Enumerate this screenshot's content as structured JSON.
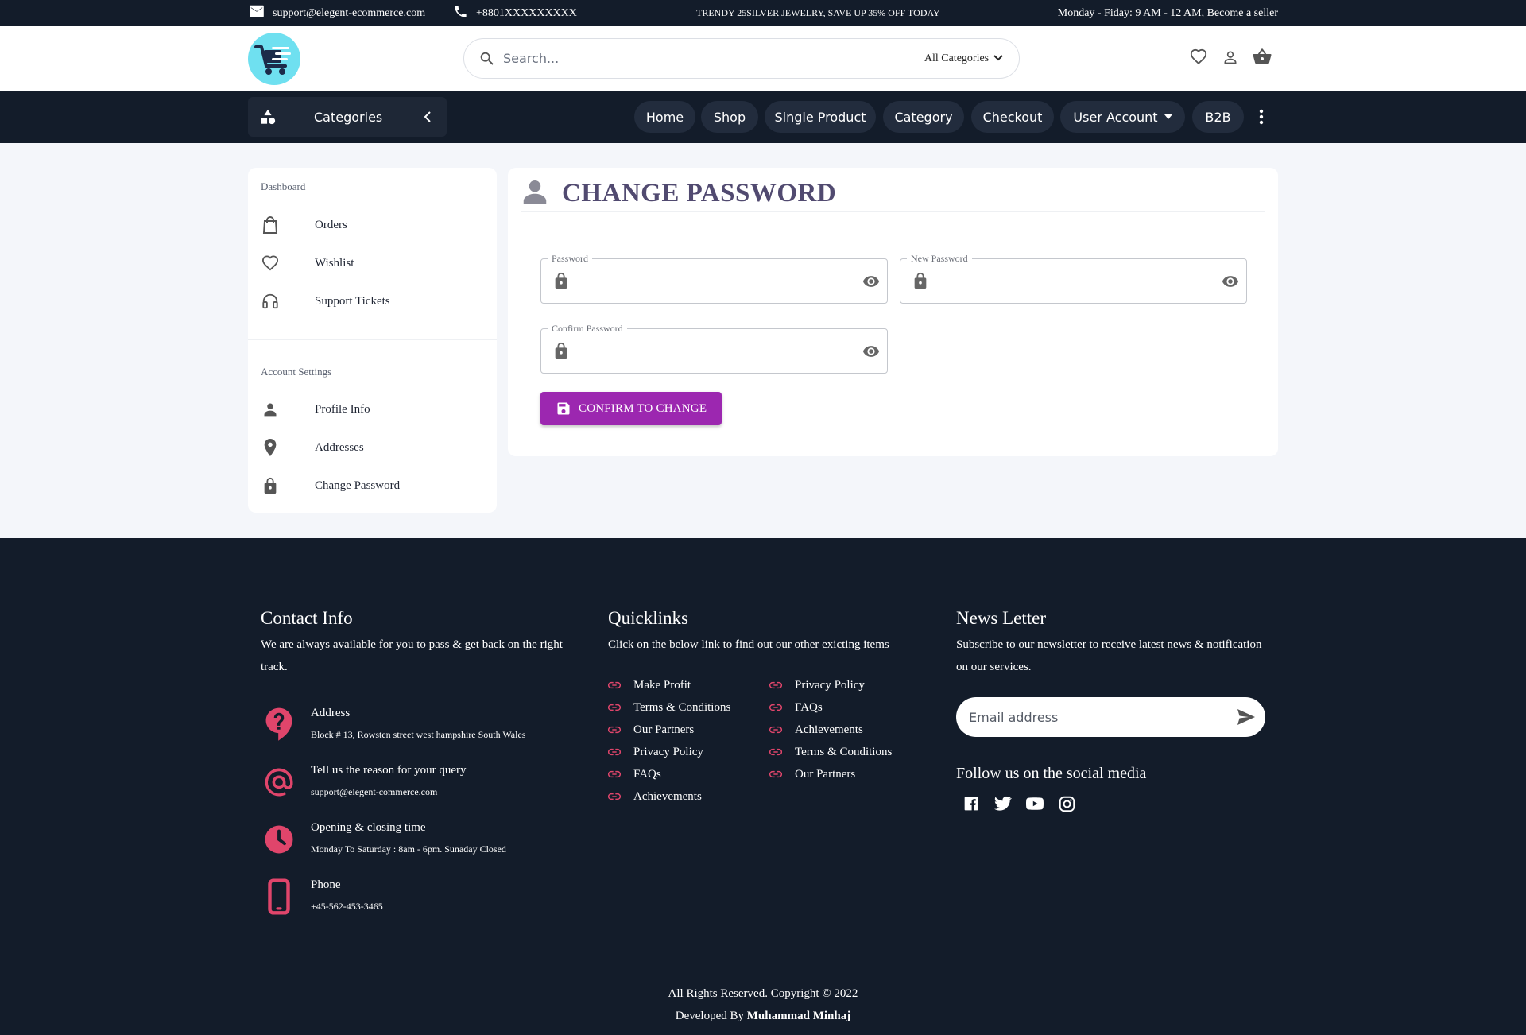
{
  "topbar": {
    "email": "support@elegent-ecommerce.com",
    "phone": "+8801XXXXXXXXX",
    "promo": "TRENDY 25SILVER JEWELRY, SAVE UP 35% OFF TODAY",
    "hours": "Monday - Fiday: 9 AM - 12 AM, Become a seller"
  },
  "header": {
    "search_placeholder": "Search...",
    "category_select": "All Categories"
  },
  "nav": {
    "categories_label": "Categories",
    "items": [
      "Home",
      "Shop",
      "Single Product",
      "Category",
      "Checkout",
      "User Account",
      "B2B"
    ]
  },
  "sidebar": {
    "dashboard_heading": "Dashboard",
    "dashboard_items": [
      "Orders",
      "Wishlist",
      "Support Tickets"
    ],
    "settings_heading": "Account Settings",
    "settings_items": [
      "Profile Info",
      "Addresses",
      "Change Password"
    ]
  },
  "main": {
    "title": "CHANGE PASSWORD",
    "fields": {
      "password_label": "Password",
      "new_password_label": "New Password",
      "confirm_password_label": "Confirm Password"
    },
    "confirm_button": "CONFIRM TO CHANGE"
  },
  "footer": {
    "contact": {
      "heading": "Contact Info",
      "text": "We are always available for you to pass & get back on the right track.",
      "rows": [
        {
          "title": "Address",
          "value": "Block # 13, Rowsten street west hampshire South Wales"
        },
        {
          "title": "Tell us the reason for your query",
          "value": "support@elegent-commerce.com"
        },
        {
          "title": "Opening & closing time",
          "value": "Monday To Saturday : 8am - 6pm. Sunaday Closed"
        },
        {
          "title": "Phone",
          "value": "+45-562-453-3465"
        }
      ]
    },
    "quicklinks": {
      "heading": "Quicklinks",
      "text": "Click on the below link to find out our other exicting items",
      "col1": [
        "Make Profit",
        "Terms & Conditions",
        "Our Partners",
        "Privacy Policy",
        "FAQs",
        "Achievements"
      ],
      "col2": [
        "Privacy Policy",
        "FAQs",
        "Achievements",
        "Terms & Conditions",
        "Our Partners"
      ]
    },
    "newsletter": {
      "heading": "News Letter",
      "text": "Subscribe to our newsletter to receive latest news & notification on our services.",
      "email_placeholder": "Email address",
      "social_heading": "Follow us on the social media"
    },
    "copyright": "All Rights Reserved. Copyright © 2022",
    "developed_by": "Developed By",
    "developer": "Muhammad Minhaj"
  },
  "colors": {
    "dark": "#131c2a",
    "accent_purple": "#9c27b0",
    "footer_icon_red": "#e0456b",
    "title_purple": "#514a70"
  },
  "icons": [
    "mail-icon",
    "phone-icon",
    "search-icon",
    "chevron-down-icon",
    "heart-icon",
    "user-icon",
    "basket-icon",
    "shapes-icon",
    "chevron-left-icon",
    "more-vert-icon",
    "bag-icon",
    "headset-icon",
    "location-icon",
    "lock-icon",
    "eye-icon",
    "save-icon",
    "question-icon",
    "at-icon",
    "clock-icon",
    "smartphone-icon",
    "link-icon",
    "send-icon",
    "facebook-icon",
    "twitter-icon",
    "youtube-icon",
    "instagram-icon"
  ]
}
